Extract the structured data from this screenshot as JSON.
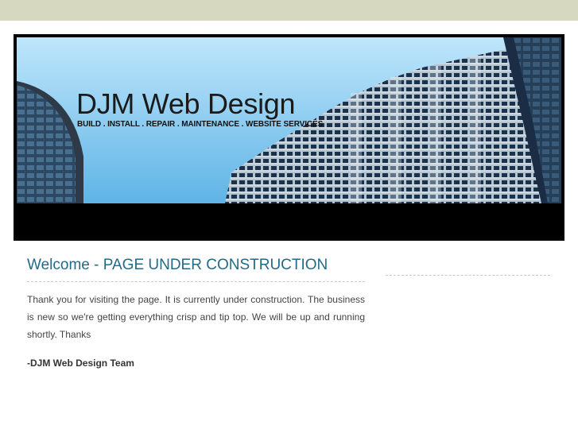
{
  "header": {
    "site_title": "DJM Web Design",
    "tagline": "BUILD . INSTALL . REPAIR . MAINTENANCE . WEBSITE SERVICES"
  },
  "main": {
    "heading": "Welcome - PAGE UNDER CONSTRUCTION",
    "paragraph": "Thank you for visiting the page. It is currently under construction. The business is new so we're getting everything crisp and tip top. We will be up and running shortly. Thanks",
    "signature": "-DJM Web Design Team"
  },
  "colors": {
    "top_band": "#d6d9bf",
    "sky_top": "#bfe6fb",
    "sky_bottom": "#5fb4e6",
    "heading": "#236a87",
    "frame": "#000000"
  }
}
